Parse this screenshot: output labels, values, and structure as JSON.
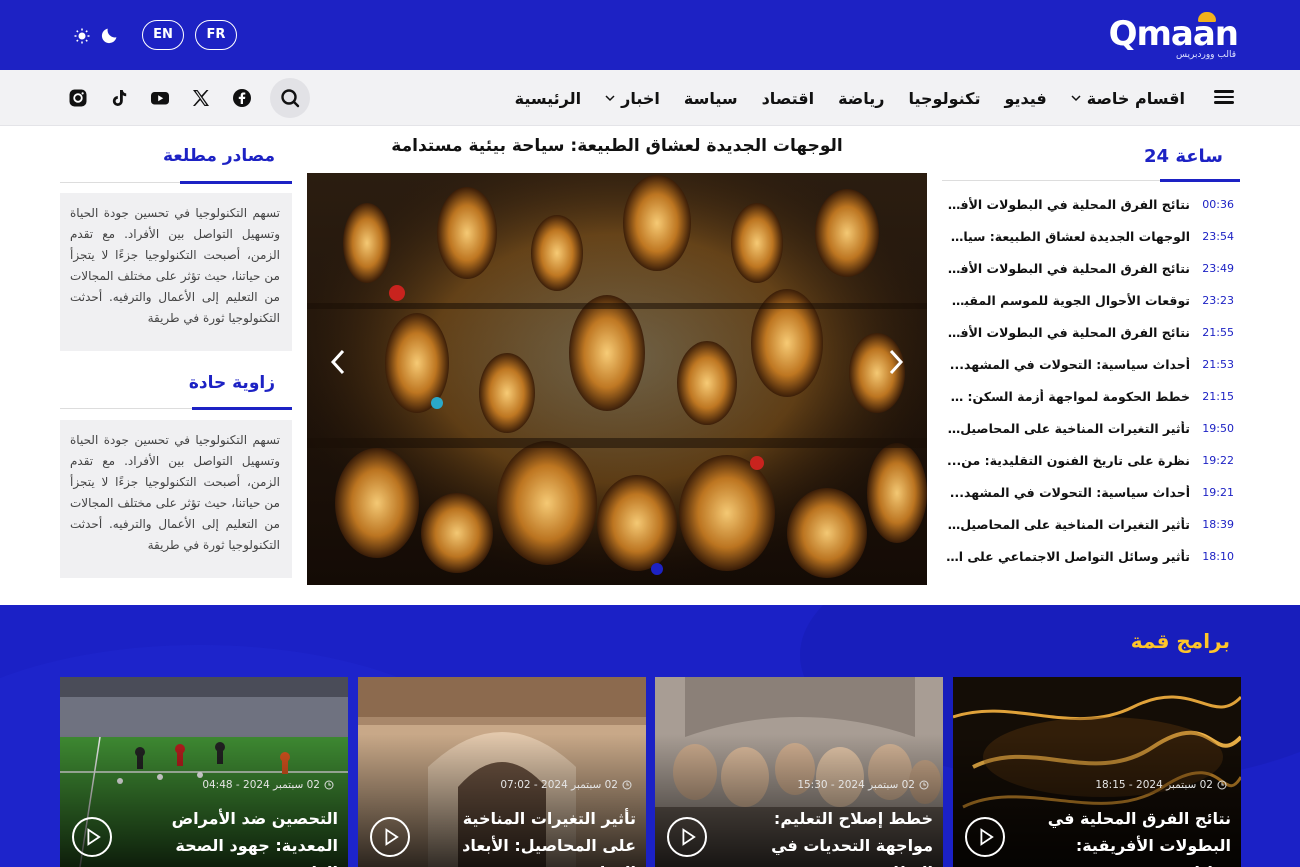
{
  "brand": {
    "logo_text": "Qmaan",
    "logo_tagline": "قالب ووردبريس",
    "primary": "#1d22c4",
    "accent": "#ffc529"
  },
  "header": {
    "lang_en": "EN",
    "lang_fr": "FR",
    "theme_light_icon": "sun-icon",
    "theme_dark_icon": "moon-icon"
  },
  "nav": {
    "menu_icon": "hamburger-icon",
    "items": [
      {
        "label": "الرئيسية",
        "dropdown": false
      },
      {
        "label": "اخبار",
        "dropdown": true
      },
      {
        "label": "سياسة",
        "dropdown": false
      },
      {
        "label": "اقتصاد",
        "dropdown": false
      },
      {
        "label": "رياضة",
        "dropdown": false
      },
      {
        "label": "تكنولوجيا",
        "dropdown": false
      },
      {
        "label": "فيديو",
        "dropdown": false
      },
      {
        "label": "اقسام خاصة",
        "dropdown": true
      }
    ],
    "social": [
      "facebook-icon",
      "x-icon",
      "youtube-icon",
      "tiktok-icon",
      "instagram-icon"
    ]
  },
  "latest": {
    "title": "24 ساعة",
    "items": [
      {
        "time": "00:36",
        "title": "نتائج الفرق المحلية في البطولات الأفريقي..."
      },
      {
        "time": "23:54",
        "title": "الوجهات الجديدة لعشاق الطبيعة: سياحة..."
      },
      {
        "time": "23:49",
        "title": "نتائج الفرق المحلية في البطولات الأفريقي..."
      },
      {
        "time": "23:23",
        "title": "توقعات الأحوال الجوية للموسم المقبل:..."
      },
      {
        "time": "21:55",
        "title": "نتائج الفرق المحلية في البطولات الأفريقي..."
      },
      {
        "time": "21:53",
        "title": "أحداث سياسية: التحولات في المشهد..."
      },
      {
        "time": "21:15",
        "title": "خطط الحكومة لمواجهة أزمة السكن: ماذ..."
      },
      {
        "time": "19:50",
        "title": "تأثير التغيرات المناخية على المحاصيل:..."
      },
      {
        "time": "19:22",
        "title": "نظرة على تاريخ الفنون التقليدية: من..."
      },
      {
        "time": "19:21",
        "title": "أحداث سياسية: التحولات في المشهد..."
      },
      {
        "time": "18:39",
        "title": "تأثير التغيرات المناخية على المحاصيل:..."
      },
      {
        "time": "18:10",
        "title": "تأثير وسائل التواصل الاجتماعي على الشبا..."
      }
    ]
  },
  "hero": {
    "title": "الوجهات الجديدة لعشاق الطبيعة: سياحة بيئية مستدامة",
    "prev_icon": "chevron-left-icon",
    "next_icon": "chevron-right-icon"
  },
  "side": {
    "box1_title": "مصادر مطلعة",
    "box1_text": "تسهم التكنولوجيا في تحسين جودة الحياة وتسهيل التواصل بين الأفراد. مع تقدم الزمن، أصبحت التكنولوجيا جزءًا لا يتجزأ من حياتنا، حيث تؤثر على مختلف المجالات من التعليم إلى الأعمال والترفيه. أحدثت التكنولوجيا ثورة في طريقة",
    "box2_title": "زاوية حادة",
    "box2_text": "تسهم التكنولوجيا في تحسين جودة الحياة وتسهيل التواصل بين الأفراد. مع تقدم الزمن، أصبحت التكنولوجيا جزءًا لا يتجزأ من حياتنا، حيث تؤثر على مختلف المجالات من التعليم إلى الأعمال والترفيه. أحدثت التكنولوجيا ثورة في طريقة"
  },
  "programs": {
    "title": "برامج قمة",
    "cards": [
      {
        "meta": "02 سبتمبر 2024 - 18:15",
        "title": "نتائج الفرق المحلية في البطولات الأفريقية: تحليل..."
      },
      {
        "meta": "02 سبتمبر 2024 - 15:30",
        "title": "خطط إصلاح التعليم: مواجهة التحديات في النظام..."
      },
      {
        "meta": "02 سبتمبر 2024 - 07:02",
        "title": "تأثير التغيرات المناخية على المحاصيل: الأبعاد الزراعية"
      },
      {
        "meta": "02 سبتمبر 2024 - 04:48",
        "title": "التحصين ضد الأمراض المعدية: جهود الصحة العام..."
      }
    ]
  }
}
